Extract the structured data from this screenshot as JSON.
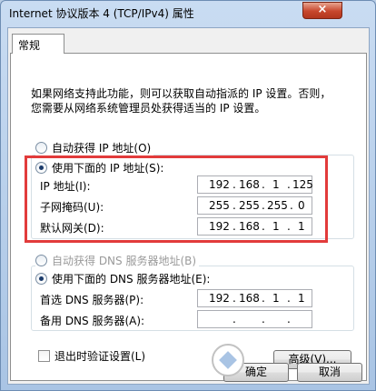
{
  "window": {
    "title": "Internet 协议版本 4 (TCP/IPv4) 属性",
    "close_label": "×"
  },
  "tabs": [
    {
      "label": "常规"
    }
  ],
  "description": "如果网络支持此功能，则可以获取自动指派的 IP 设置。否则，\n您需要从网络系统管理员处获得适当的 IP 设置。",
  "ip": {
    "auto_label": "自动获得 IP 地址(O)",
    "manual_label": "使用下面的 IP 地址(S):",
    "fields": [
      {
        "label": "IP 地址(I):",
        "octets": [
          "192",
          "168",
          "1",
          "125"
        ]
      },
      {
        "label": "子网掩码(U):",
        "octets": [
          "255",
          "255",
          "255",
          "0"
        ]
      },
      {
        "label": "默认网关(D):",
        "octets": [
          "192",
          "168",
          "1",
          "1"
        ]
      }
    ]
  },
  "dns": {
    "auto_label": "自动获得 DNS 服务器地址(B)",
    "manual_label": "使用下面的 DNS 服务器地址(E):",
    "fields": [
      {
        "label": "首选 DNS 服务器(P):",
        "octets": [
          "192",
          "168",
          "1",
          "1"
        ]
      },
      {
        "label": "备用 DNS 服务器(A):",
        "octets": [
          "",
          "",
          "",
          ""
        ]
      }
    ]
  },
  "options": {
    "validate_label": "退出时验证设置(L)",
    "advanced_label": "高级(V)..."
  },
  "footer": {
    "ok_label": "确定",
    "cancel_label": "取消"
  },
  "colors": {
    "highlight": "#e23b3b"
  }
}
